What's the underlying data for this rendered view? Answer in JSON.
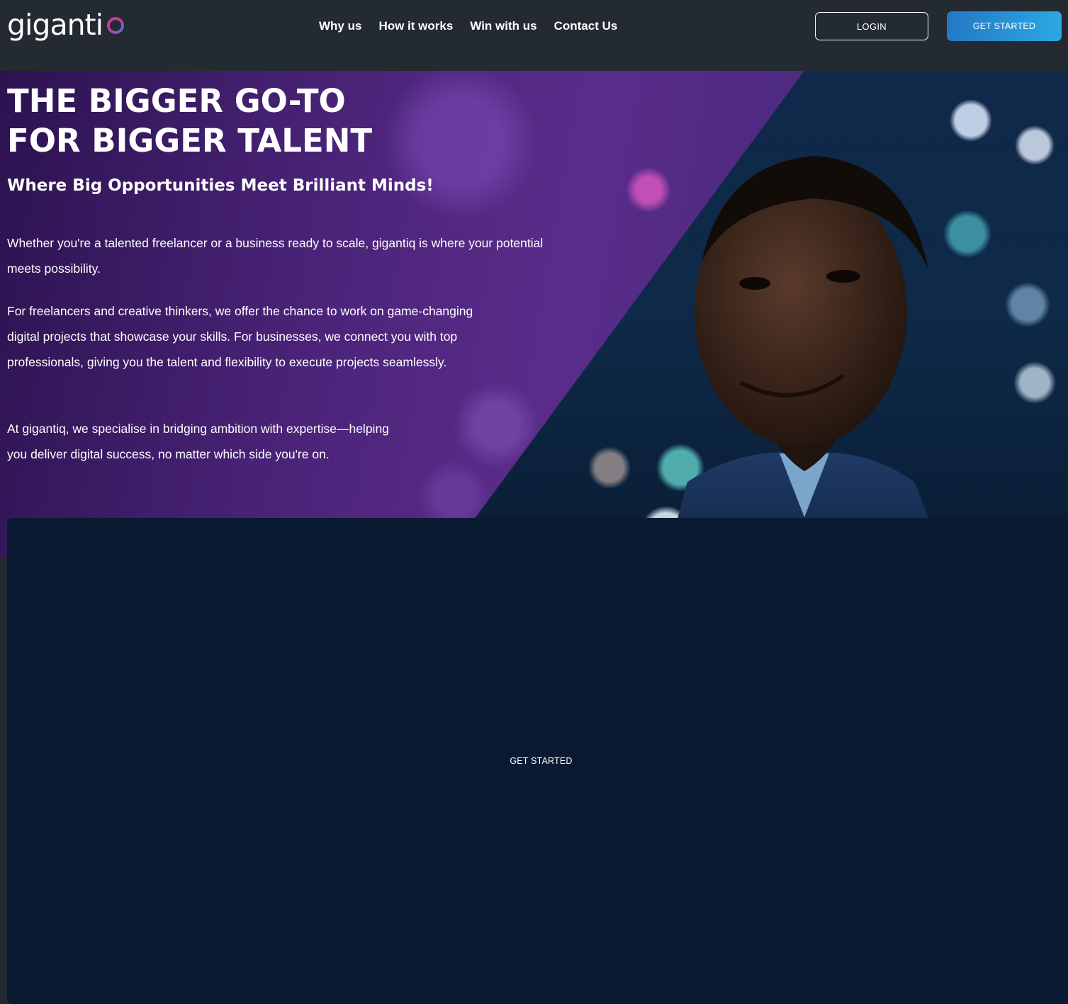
{
  "header": {
    "logo_text": "giganti",
    "logo_mark": "q",
    "nav": [
      "Why us",
      "How it works",
      "Win with us",
      "Contact Us"
    ],
    "login_label": "LOGIN",
    "get_started_label": "GET STARTED"
  },
  "hero": {
    "title_line1": "THE BIGGER GO-TO",
    "title_line2": "FOR BIGGER TALENT",
    "subtitle": "Where Big Opportunities Meet Brilliant Minds!",
    "paragraphs": [
      "Whether you're a talented freelancer or a business ready to scale, gigantiq is where your potential meets possibility.",
      "For freelancers and creative thinkers, we offer the chance to work on game-changing digital projects that showcase your skills. For businesses, we connect you with top professionals, giving you the talent and flexibility to execute projects seamlessly.",
      "At gigantiq, we specialise in bridging ambition with expertise—helping you deliver digital success, no matter which side you're on."
    ],
    "cta_label": "GET STARTED"
  },
  "colors": {
    "header_bg": "#232a31",
    "accent_blue": "#2ba8e2",
    "overlay_purple": "#5a2c8a",
    "logo_gradient_start": "#d83a8a",
    "logo_gradient_end": "#3f7fe0"
  }
}
